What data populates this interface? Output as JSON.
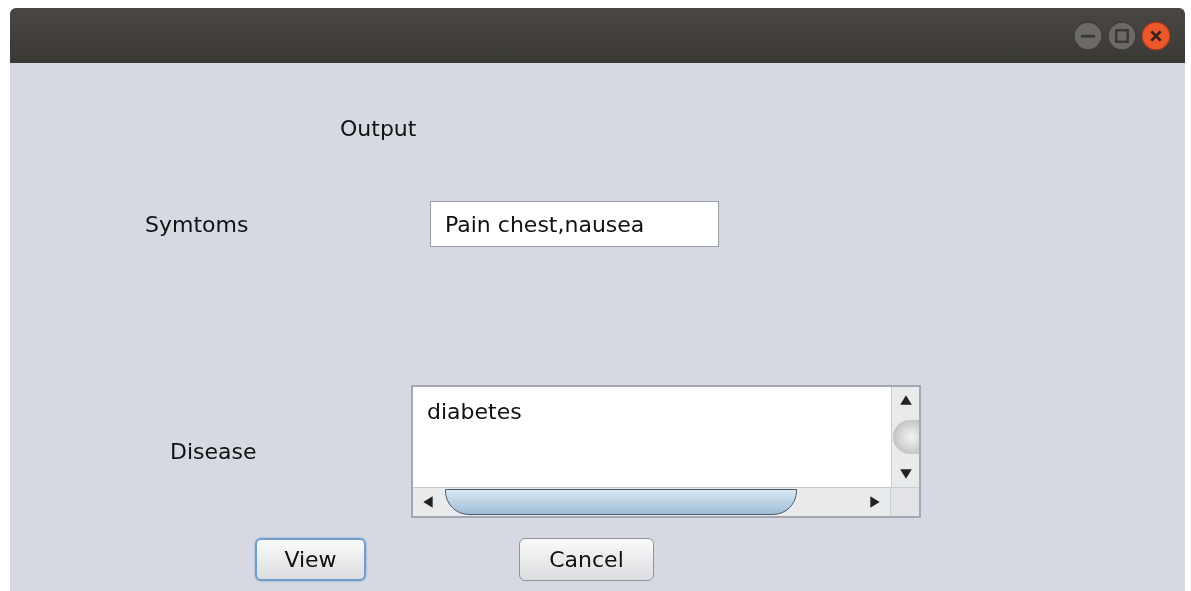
{
  "title_bar": {
    "controls": [
      {
        "kind": "minimize"
      },
      {
        "kind": "maximize"
      },
      {
        "kind": "close"
      }
    ]
  },
  "heading": "Output",
  "symptoms": {
    "label": "Symtoms",
    "value": "Pain chest,nausea"
  },
  "disease": {
    "label": "Disease",
    "value": "diabetes"
  },
  "buttons": [
    {
      "label": "View",
      "focused": true
    },
    {
      "label": "Cancel",
      "focused": false
    }
  ]
}
